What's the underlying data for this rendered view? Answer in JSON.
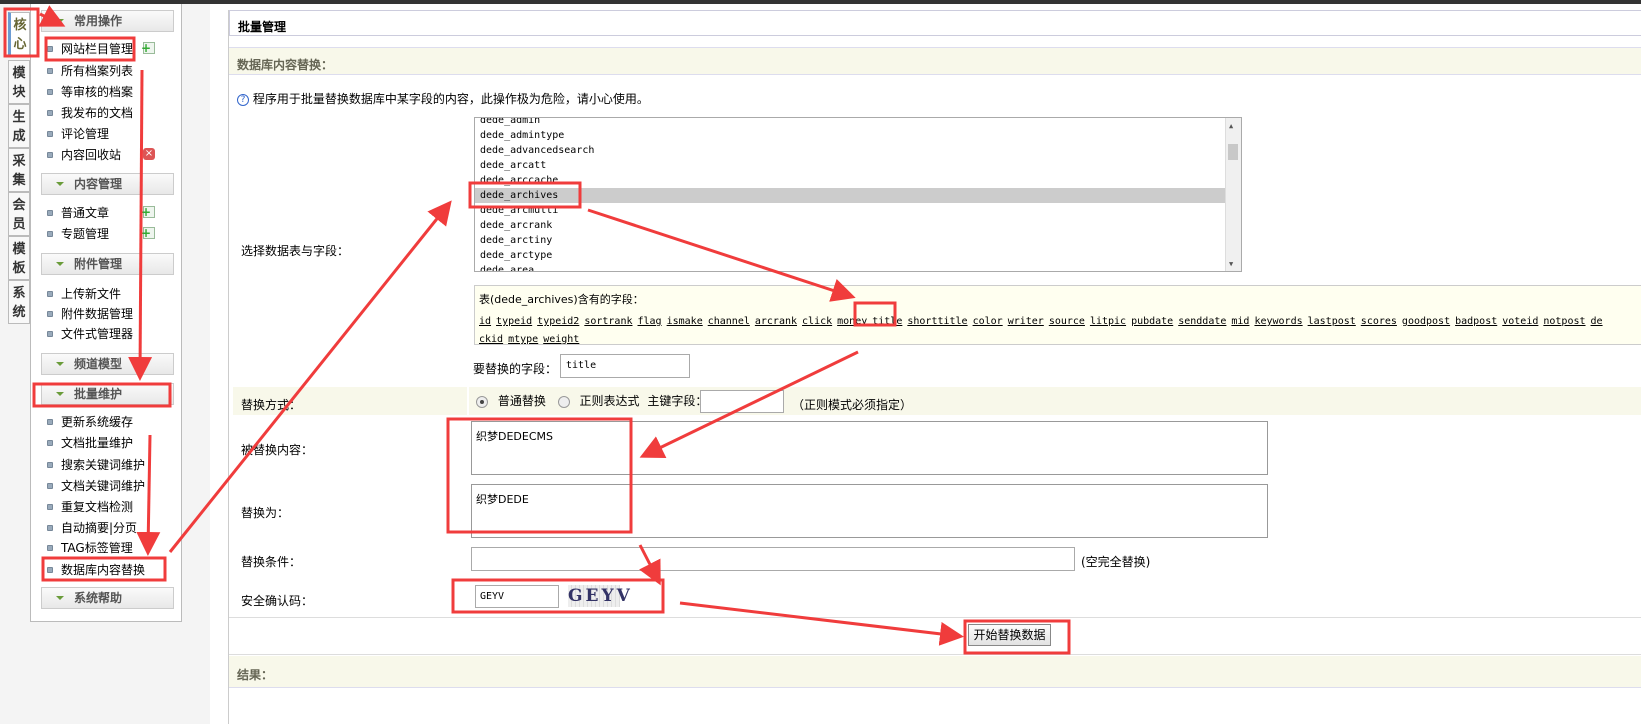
{
  "left_tabs": [
    "核心",
    "模块",
    "生成",
    "采集",
    "会员",
    "模板",
    "系统"
  ],
  "sidebar": {
    "sections": [
      {
        "title": "常用操作",
        "items": [
          "网站栏目管理",
          "所有档案列表",
          "等审核的档案",
          "我发布的文档",
          "评论管理",
          "内容回收站"
        ]
      },
      {
        "title": "内容管理",
        "items": [
          "普通文章",
          "专题管理"
        ]
      },
      {
        "title": "附件管理",
        "items": [
          "上传新文件",
          "附件数据管理",
          "文件式管理器"
        ]
      },
      {
        "title": "频道模型",
        "items": []
      },
      {
        "title": "批量维护",
        "items": [
          "更新系统缓存",
          "文档批量维护",
          "搜索关键词维护",
          "文档关键词维护",
          "重复文档检测",
          "自动摘要|分页",
          "TAG标签管理",
          "数据库内容替换"
        ]
      },
      {
        "title": "系统帮助",
        "items": []
      }
    ]
  },
  "main": {
    "title": "批量管理",
    "section_title": "数据库内容替换：",
    "notice": "程序用于批量替换数据库中某字段的内容，此操作极为危险，请小心使用。",
    "table_label": "选择数据表与字段：",
    "tables": [
      "dede_admin",
      "dede_admintype",
      "dede_advancedsearch",
      "dede_arcatt",
      "dede_arccache",
      "dede_archives",
      "dede_arcmulti",
      "dede_arcrank",
      "dede_arctiny",
      "dede_arctype",
      "dede_area"
    ],
    "selected_table": "dede_archives",
    "fields_caption": "表(dede_archives)含有的字段：",
    "fields_line1": [
      "id",
      "typeid",
      "typeid2",
      "sortrank",
      "flag",
      "ismake",
      "channel",
      "arcrank",
      "click",
      "money",
      "title",
      "shorttitle",
      "color",
      "writer",
      "source",
      "litpic",
      "pubdate",
      "senddate",
      "mid",
      "keywords",
      "lastpost",
      "scores",
      "goodpost",
      "badpost",
      "voteid",
      "notpost",
      "de"
    ],
    "fields_line2": [
      "ckid",
      "mtype",
      "weight"
    ],
    "field_label": "要替换的字段：",
    "field_value": "title",
    "method_label": "替换方式：",
    "method_normal": "普通替换",
    "method_regex": "正则表达式",
    "key_field_label": "主键字段：",
    "key_field_value": "",
    "regex_note": "（正则模式必须指定）",
    "replace_from_label": "被替换内容：",
    "replace_from_value": "织梦DEDECMS",
    "replace_to_label": "替换为：",
    "replace_to_value": "织梦DEDE",
    "condition_label": "替换条件：",
    "condition_value": "",
    "condition_note": "(空完全替换)",
    "captcha_label": "安全确认码：",
    "captcha_value": "GEYV",
    "captcha_image_text": "GEYV",
    "submit_label": "开始替换数据",
    "result_title": "结果："
  },
  "colors": {
    "annotation": "#f03c3c",
    "section_bg": "#f8f8ea",
    "selected_row": "#cccccc"
  }
}
